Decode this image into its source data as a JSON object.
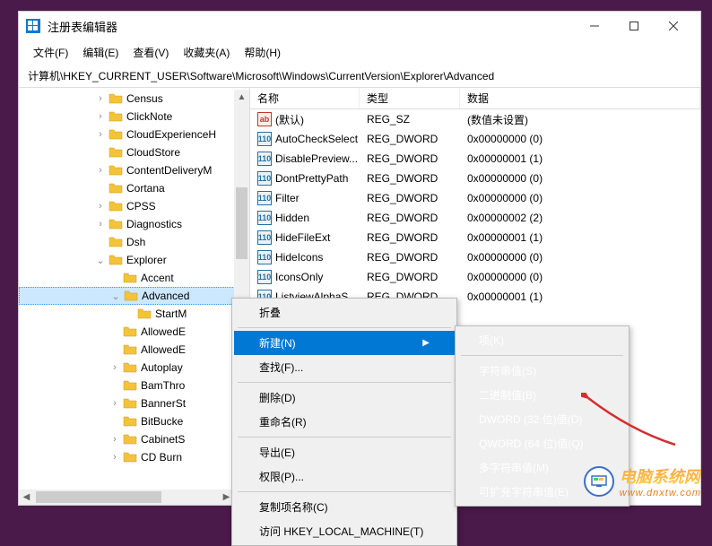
{
  "window": {
    "title": "注册表编辑器"
  },
  "menubar": [
    {
      "label": "文件(F)"
    },
    {
      "label": "编辑(E)"
    },
    {
      "label": "查看(V)"
    },
    {
      "label": "收藏夹(A)"
    },
    {
      "label": "帮助(H)"
    }
  ],
  "path": "计算机\\HKEY_CURRENT_USER\\Software\\Microsoft\\Windows\\CurrentVersion\\Explorer\\Advanced",
  "tree": [
    {
      "depth": 5,
      "exp": ">",
      "label": "Census"
    },
    {
      "depth": 5,
      "exp": ">",
      "label": "ClickNote"
    },
    {
      "depth": 5,
      "exp": ">",
      "label": "CloudExperienceH"
    },
    {
      "depth": 5,
      "exp": " ",
      "label": "CloudStore"
    },
    {
      "depth": 5,
      "exp": ">",
      "label": "ContentDeliveryM"
    },
    {
      "depth": 5,
      "exp": " ",
      "label": "Cortana"
    },
    {
      "depth": 5,
      "exp": ">",
      "label": "CPSS"
    },
    {
      "depth": 5,
      "exp": ">",
      "label": "Diagnostics"
    },
    {
      "depth": 5,
      "exp": " ",
      "label": "Dsh"
    },
    {
      "depth": 5,
      "exp": "v",
      "label": "Explorer"
    },
    {
      "depth": 6,
      "exp": " ",
      "label": "Accent"
    },
    {
      "depth": 6,
      "exp": "v",
      "label": "Advanced",
      "selected": true
    },
    {
      "depth": 7,
      "exp": " ",
      "label": "StartM"
    },
    {
      "depth": 6,
      "exp": " ",
      "label": "AllowedE"
    },
    {
      "depth": 6,
      "exp": " ",
      "label": "AllowedE"
    },
    {
      "depth": 6,
      "exp": ">",
      "label": "Autoplay"
    },
    {
      "depth": 6,
      "exp": " ",
      "label": "BamThro"
    },
    {
      "depth": 6,
      "exp": ">",
      "label": "BannerSt"
    },
    {
      "depth": 6,
      "exp": " ",
      "label": "BitBucke"
    },
    {
      "depth": 6,
      "exp": ">",
      "label": "CabinetS"
    },
    {
      "depth": 6,
      "exp": ">",
      "label": "CD Burn"
    }
  ],
  "columns": {
    "name": "名称",
    "type": "类型",
    "data": "数据"
  },
  "values": [
    {
      "icon": "sz",
      "name": "(默认)",
      "type": "REG_SZ",
      "data": "(数值未设置)"
    },
    {
      "icon": "dw",
      "name": "AutoCheckSelect",
      "type": "REG_DWORD",
      "data": "0x00000000 (0)"
    },
    {
      "icon": "dw",
      "name": "DisablePreview...",
      "type": "REG_DWORD",
      "data": "0x00000001 (1)"
    },
    {
      "icon": "dw",
      "name": "DontPrettyPath",
      "type": "REG_DWORD",
      "data": "0x00000000 (0)"
    },
    {
      "icon": "dw",
      "name": "Filter",
      "type": "REG_DWORD",
      "data": "0x00000000 (0)"
    },
    {
      "icon": "dw",
      "name": "Hidden",
      "type": "REG_DWORD",
      "data": "0x00000002 (2)"
    },
    {
      "icon": "dw",
      "name": "HideFileExt",
      "type": "REG_DWORD",
      "data": "0x00000001 (1)"
    },
    {
      "icon": "dw",
      "name": "HideIcons",
      "type": "REG_DWORD",
      "data": "0x00000000 (0)"
    },
    {
      "icon": "dw",
      "name": "IconsOnly",
      "type": "REG_DWORD",
      "data": "0x00000000 (0)"
    },
    {
      "icon": "dw",
      "name": "ListviewAlphaS...",
      "type": "REG_DWORD",
      "data": "0x00000001 (1)"
    }
  ],
  "context_menu": [
    {
      "label": "折叠"
    },
    {
      "sep": true
    },
    {
      "label": "新建(N)",
      "arrow": true,
      "highlight": true
    },
    {
      "label": "查找(F)..."
    },
    {
      "sep": true
    },
    {
      "label": "删除(D)"
    },
    {
      "label": "重命名(R)"
    },
    {
      "sep": true
    },
    {
      "label": "导出(E)"
    },
    {
      "label": "权限(P)..."
    },
    {
      "sep": true
    },
    {
      "label": "复制项名称(C)"
    },
    {
      "label": "访问 HKEY_LOCAL_MACHINE(T)"
    }
  ],
  "submenu": [
    {
      "label": "项(K)"
    },
    {
      "sep": true
    },
    {
      "label": "字符串值(S)"
    },
    {
      "label": "二进制值(B)"
    },
    {
      "label": "DWORD (32 位)值(D)"
    },
    {
      "label": "QWORD (64 位)值(Q)"
    },
    {
      "label": "多字符串值(M)"
    },
    {
      "label": "可扩充字符串值(E)"
    }
  ],
  "watermark": {
    "line1": "电脑系统网",
    "line2": "www.dnxtw.com"
  }
}
